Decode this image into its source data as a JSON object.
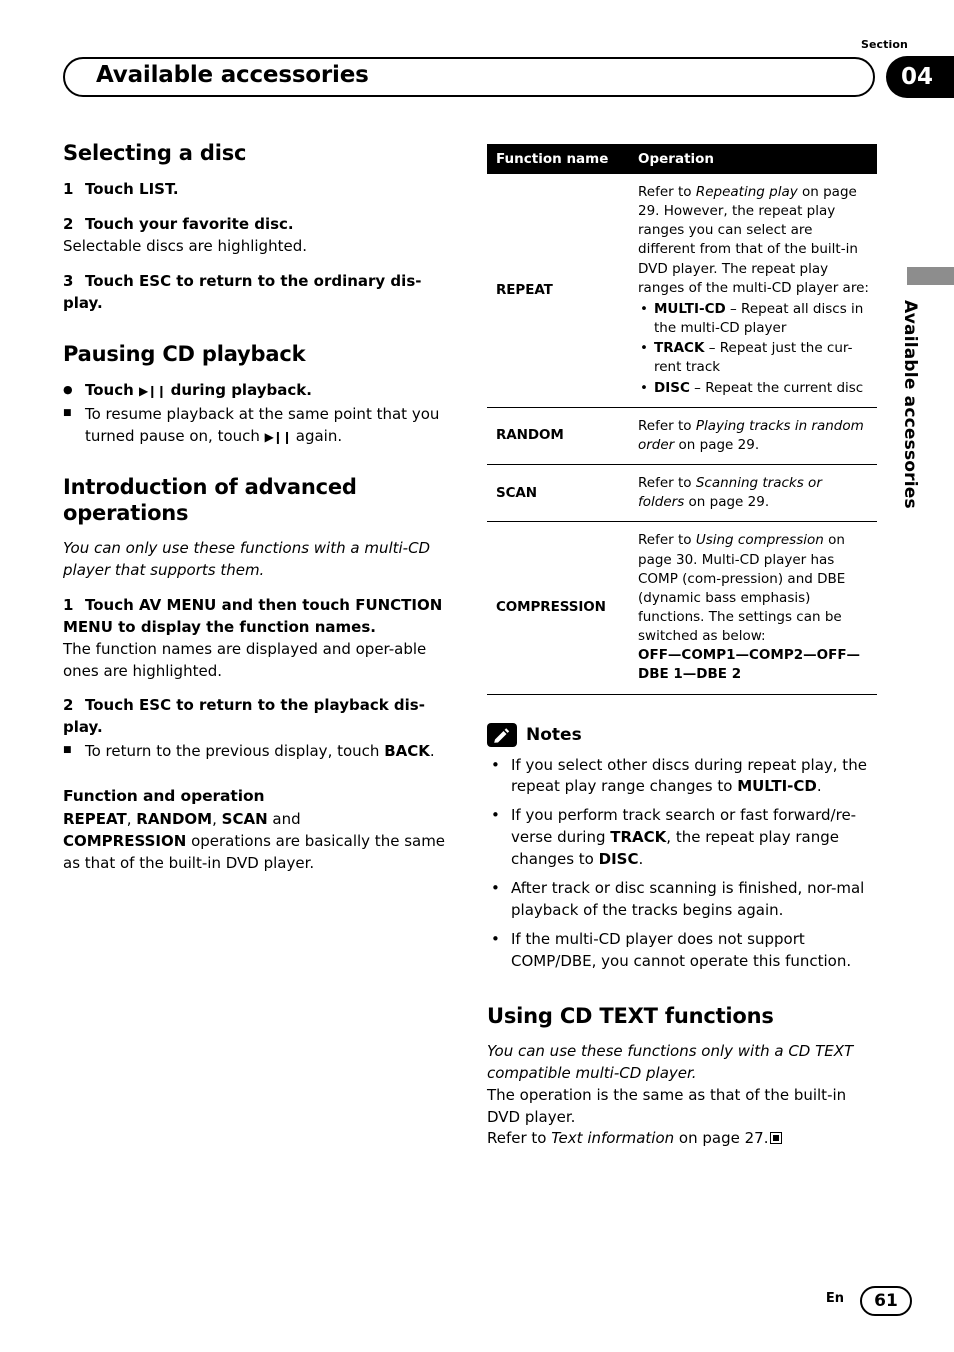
{
  "header": {
    "section_label": "Section",
    "title": "Available accessories",
    "section_number": "04"
  },
  "side_tab": {
    "text": "Available accessories"
  },
  "left_column": {
    "h_selecting": "Selecting a disc",
    "step1_num": "1",
    "step1_text": "Touch LIST.",
    "step2_num": "2",
    "step2_text": "Touch your favorite disc.",
    "step2_body": "Selectable discs are highlighted.",
    "step3_num": "3",
    "step3_text": "Touch ESC to return to the ordinary dis-play.",
    "h_pausing": "Pausing CD playback",
    "pause_bullet_pre": "Touch ",
    "pause_bullet_post": " during playback.",
    "pause_sq_pre": "To resume playback at the same point that you turned pause on, touch ",
    "pause_sq_post": " again.",
    "h_intro": "Introduction of advanced operations",
    "intro_italic": "You can only use these functions with a multi-CD player that supports them.",
    "istep1_num": "1",
    "istep1_text": "Touch AV MENU and then touch FUNCTION MENU to display the function names.",
    "istep1_body": "The function names are displayed and oper-able ones are highlighted.",
    "istep2_num": "2",
    "istep2_text": "Touch ESC to return to the playback dis-play.",
    "istep2_sq_pre": "To return to the previous display, touch ",
    "istep2_sq_bold": "BACK",
    "istep2_sq_post": ".",
    "h_function_operation": "Function and operation",
    "fo_line1_a": "REPEAT",
    "fo_line1_b": "RANDOM",
    "fo_line1_c": "SCAN",
    "fo_line1_and": " and",
    "fo_line2_bold": "COMPRESSION",
    "fo_line2_rest": " operations are basically the same as that of the built-in DVD player."
  },
  "table": {
    "header_col1": "Function name",
    "header_col2": "Operation",
    "rows": [
      {
        "name": "REPEAT",
        "intro_pre": "Refer to ",
        "intro_italic": "Repeating play",
        "intro_post": " on page 29. However, the repeat play ranges you can select are different from that of the built-in DVD player. The repeat play ranges of the multi-CD player are:",
        "bullets": [
          {
            "bold": "MULTI-CD",
            "rest": " – Repeat all discs in the multi-CD player"
          },
          {
            "bold": "TRACK",
            "rest": " – Repeat just the cur-rent track"
          },
          {
            "bold": "DISC",
            "rest": " – Repeat the current disc"
          }
        ]
      },
      {
        "name": "RANDOM",
        "intro_pre": "Refer to ",
        "intro_italic": "Playing tracks in random order",
        "intro_post": " on page 29.",
        "bullets": []
      },
      {
        "name": "SCAN",
        "intro_pre": "Refer to ",
        "intro_italic": "Scanning tracks or folders",
        "intro_post": " on page 29.",
        "bullets": []
      },
      {
        "name": "COMPRESSION",
        "intro_pre": "Refer to ",
        "intro_italic": "Using compression",
        "intro_post": " on page 30. Multi-CD player has COMP (com-pression) and DBE (dynamic bass emphasis) functions. The settings can be switched as below:",
        "settings": "OFF—COMP1—COMP2—OFF—DBE 1—DBE 2",
        "bullets": []
      }
    ]
  },
  "notes": {
    "title": "Notes",
    "items": [
      {
        "pre": "If you select other discs during repeat play, the repeat play range changes to ",
        "bold": "MULTI-CD",
        "post": "."
      },
      {
        "pre": "If you perform track search or fast forward/re-verse during ",
        "bold": "TRACK",
        "mid": ", the repeat play range changes to ",
        "bold2": "DISC",
        "post": "."
      },
      {
        "pre": "After track or disc scanning is finished, nor-mal playback of the tracks begins again.",
        "bold": "",
        "post": ""
      },
      {
        "pre": "If the multi-CD player does not support COMP/DBE, you cannot operate this function.",
        "bold": "",
        "post": ""
      }
    ]
  },
  "cd_text": {
    "heading": "Using CD TEXT functions",
    "italic": "You can use these functions only with a CD TEXT compatible multi-CD player.",
    "line2": "The operation is the same as that of the built-in DVD player.",
    "line3_pre": "Refer to ",
    "line3_italic": "Text information",
    "line3_post": " on page 27."
  },
  "footer": {
    "lang": "En",
    "page": "61"
  }
}
